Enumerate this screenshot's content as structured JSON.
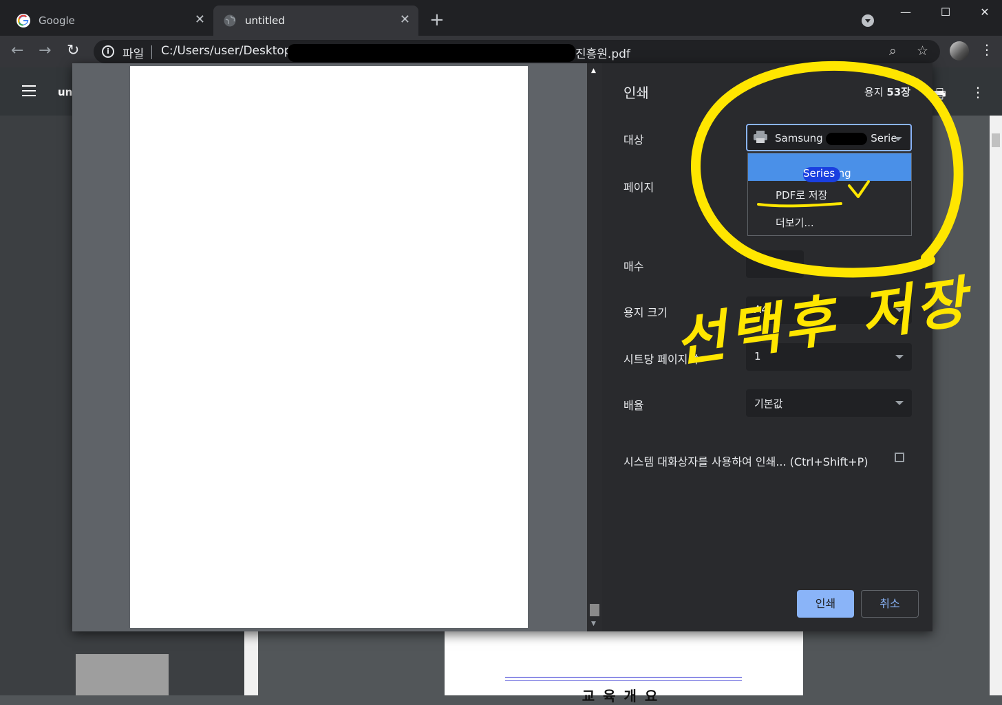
{
  "tabs": [
    {
      "title": "Google",
      "close": "✕"
    },
    {
      "title": "untitled",
      "close": "✕"
    }
  ],
  "new_tab": "+",
  "window_controls": {
    "minimize": "—",
    "maximize": "☐",
    "close": "✕"
  },
  "address_bar": {
    "scheme_label": "파일",
    "url_prefix": "C:/Users/user/Desktop/",
    "url_suffix": "진흥원.pdf"
  },
  "pdf_viewer": {
    "title": "un",
    "page_heading": "교육개요"
  },
  "print_dialog": {
    "title": "인쇄",
    "sheets_label": "용지",
    "sheets_count": "53장",
    "destination": {
      "label": "대상",
      "value_prefix": "Samsung",
      "value_suffix": "Serie",
      "options": [
        {
          "prefix": "Samsung",
          "suffix": "Series",
          "selected": true
        },
        {
          "label": "PDF로 저장",
          "selected": false
        },
        {
          "label": "더보기...",
          "selected": false
        }
      ]
    },
    "pages_label": "페이지",
    "copies_label": "매수",
    "paper_size": {
      "label": "용지 크기",
      "value": "A4"
    },
    "pages_per_sheet": {
      "label": "시트당 페이지 수",
      "value": "1"
    },
    "scale": {
      "label": "배율",
      "value": "기본값"
    },
    "system_dialog_link": "시스템 대화상자를 사용하여 인쇄... (Ctrl+Shift+P)",
    "print_button": "인쇄",
    "cancel_button": "취소"
  },
  "annotation": {
    "handwritten_text": "선택후 저장",
    "color": "#ffe600"
  },
  "colors": {
    "accent": "#8ab4f8",
    "selected_option": "#4a90e8",
    "dialog_bg": "#292a2d"
  }
}
